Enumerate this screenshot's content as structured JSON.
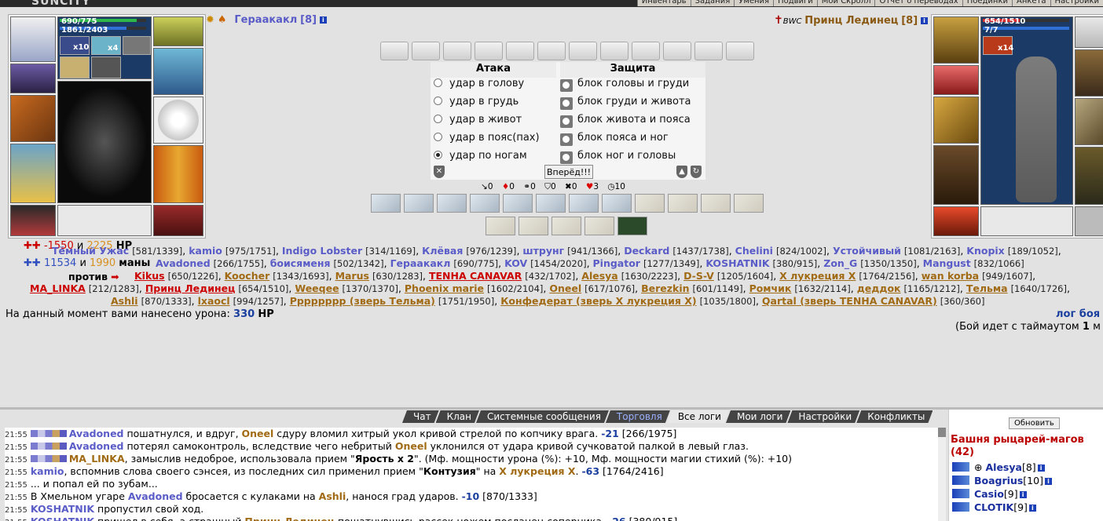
{
  "app": {
    "logo": "SUNCITY"
  },
  "top_menu": [
    "Инвентарь",
    "Задания",
    "Умения",
    "Подвиги",
    "Мой Скролл",
    "Отчет о переводах",
    "Поединки",
    "Анкета",
    "Настройки"
  ],
  "player_left": {
    "name": "Гераакакл",
    "level": "[8]",
    "hp": "690/775",
    "mana": "1861/2403",
    "stack1": "x10",
    "stack2": "x4",
    "hp_fraction": 0.89,
    "mana_fraction": 0.77
  },
  "player_right": {
    "name": "Принц Лединец",
    "level": "[8]",
    "hp": "654/1510",
    "mana": "7/7",
    "stack1": "x14",
    "clan_tag": "BWC",
    "hp_fraction": 0.43,
    "mana_fraction": 1.0
  },
  "attack": {
    "title": "Атака",
    "options": [
      "удар в голову",
      "удар в грудь",
      "удар в живот",
      "удар в пояс(пах)",
      "удар по ногам"
    ],
    "selected": 4
  },
  "defense": {
    "title": "Защита",
    "options": [
      "блок головы и груди",
      "блок груди и живота",
      "блок живота и пояса",
      "блок пояса и ног",
      "блок ног и головы"
    ]
  },
  "forward_button": "Вперёд!!!",
  "counters": [
    "0",
    "0",
    "0",
    "0",
    "0",
    "3",
    "10"
  ],
  "hp_summary": {
    "hp": "-1550",
    "and": "и",
    "hp2": "2225",
    "hp_label": "HP",
    "mana": "11534",
    "and2": "и",
    "mana2": "1990",
    "mana_label": "маны"
  },
  "team_left": [
    {
      "n": "Тёмный Ужас",
      "h": "[581/1339]"
    },
    {
      "n": "kamio",
      "h": "[975/1751]"
    },
    {
      "n": "Indigo Lobster",
      "h": "[314/1169]"
    },
    {
      "n": "Клёвая",
      "h": "[976/1239]"
    },
    {
      "n": "штрунг",
      "h": "[941/1366]"
    },
    {
      "n": "Deckard",
      "h": "[1437/1738]"
    },
    {
      "n": "Chelini",
      "h": "[824/1002]"
    },
    {
      "n": "Устойчивый",
      "h": "[1081/2163]"
    },
    {
      "n": "Knopix",
      "h": "[189/1052]"
    },
    {
      "n": "Avadoned",
      "h": "[266/1755]"
    },
    {
      "n": "боисяменя",
      "h": "[502/1342]"
    },
    {
      "n": "Гераакакл",
      "h": "[690/775]"
    },
    {
      "n": "KOV",
      "h": "[1454/2020]"
    },
    {
      "n": "Pingator",
      "h": "[1277/1349]"
    },
    {
      "n": "KOSHATNIK",
      "h": "[380/915]"
    },
    {
      "n": "Zon_G",
      "h": "[1350/1350]"
    },
    {
      "n": "Mangust",
      "h": "[832/1066]"
    }
  ],
  "versus": "против",
  "team_right": [
    {
      "n": "Kikus",
      "h": "[650/1226]",
      "s": "r"
    },
    {
      "n": "Koocher",
      "h": "[1343/1693]",
      "s": "e"
    },
    {
      "n": "Marus",
      "h": "[630/1283]",
      "s": "e"
    },
    {
      "n": "TENHA CANAVAR",
      "h": "[432/1702]",
      "s": "r"
    },
    {
      "n": "Alesya",
      "h": "[1630/2223]",
      "s": "e"
    },
    {
      "n": "D-S-V",
      "h": "[1205/1604]",
      "s": "e"
    },
    {
      "n": "X лукреция X",
      "h": "[1764/2156]",
      "s": "e"
    },
    {
      "n": "wan korba",
      "h": "[949/1607]",
      "s": "e"
    },
    {
      "n": "MA_LINKA",
      "h": "[212/1283]",
      "s": "r"
    },
    {
      "n": "Принц Лединец",
      "h": "[654/1510]",
      "s": "r"
    },
    {
      "n": "Weeqee",
      "h": "[1370/1370]",
      "s": "e"
    },
    {
      "n": "Phoenix marie",
      "h": "[1602/2104]",
      "s": "e"
    },
    {
      "n": "Oneel",
      "h": "[617/1076]",
      "s": "e"
    },
    {
      "n": "Berezkin",
      "h": "[601/1149]",
      "s": "e"
    },
    {
      "n": "Ромчик",
      "h": "[1632/2114]",
      "s": "e"
    },
    {
      "n": "деддок",
      "h": "[1165/1212]",
      "s": "e"
    },
    {
      "n": "Тельма",
      "h": "[1640/1726]",
      "s": "e"
    },
    {
      "n": "Ashli",
      "h": "[870/1333]",
      "s": "e"
    },
    {
      "n": "lxaocl",
      "h": "[994/1257]",
      "s": "e"
    },
    {
      "n": "Рррррррр (зверь Тельма)",
      "h": "[1751/1950]",
      "s": "e"
    },
    {
      "n": "Конфедерат (зверь X лукреция X)",
      "h": "[1035/1800]",
      "s": "e"
    },
    {
      "n": "Qartal (зверь TENHA CANAVAR)",
      "h": "[360/360]",
      "s": "e"
    }
  ],
  "damage_line": {
    "text": "На данный момент вами нанесено урона:",
    "value": "330",
    "unit": "HP"
  },
  "log_link": "лог боя",
  "timeout": {
    "prefix": "(Бой идет с таймаутом",
    "value": "1",
    "suffix": "м"
  },
  "tabs": [
    "Чат",
    "Клан",
    "Системные сообщения",
    "Торговля",
    "Все логи",
    "Мои логи",
    "Настройки",
    "Конфликты"
  ],
  "active_tab": "Все логи",
  "log": [
    {
      "t": "21:55",
      "parts": [
        [
          "p",
          "Avadoned"
        ],
        [
          "x",
          " пошатнулся, и вдруг, "
        ],
        [
          "e",
          "Oneel"
        ],
        [
          "x",
          " сдуру вломил хитрый укол кривой стрелой по копчику врага. "
        ],
        [
          "d",
          "-21"
        ],
        [
          "x",
          " [266/1975]"
        ]
      ]
    },
    {
      "t": "21:55",
      "parts": [
        [
          "p",
          "Avadoned"
        ],
        [
          "x",
          " потерял самоконтроль, вследствие чего небритый "
        ],
        [
          "e",
          "Oneel"
        ],
        [
          "x",
          " уклонился от удара кривой сучковатой палкой в левый глаз."
        ]
      ]
    },
    {
      "t": "21:55",
      "parts": [
        [
          "e",
          "MA_LINKA"
        ],
        [
          "x",
          ", замыслив недоброе, использовала прием \""
        ],
        [
          "b",
          "Ярость x 2"
        ],
        [
          "x",
          "\". (Мф. мощности урона (%): +10, Мф. мощности магии стихий (%): +10)"
        ]
      ]
    },
    {
      "t": "21:55",
      "parts": [
        [
          "p",
          "kamio"
        ],
        [
          "x",
          ", вспомнив слова своего сэнсея, из последних сил применил прием \""
        ],
        [
          "b",
          "Контузия"
        ],
        [
          "x",
          "\" на "
        ],
        [
          "e",
          "X лукреция X"
        ],
        [
          "x",
          ". "
        ],
        [
          "d",
          "-63"
        ],
        [
          "x",
          " [1764/2416]"
        ]
      ]
    },
    {
      "t": "21:55",
      "parts": [
        [
          "x",
          "... и попал ей по зубам..."
        ]
      ]
    },
    {
      "t": "21:55",
      "parts": [
        [
          "x",
          "В Хмельном угаре "
        ],
        [
          "p",
          "Avadoned"
        ],
        [
          "x",
          " бросается с кулаками на "
        ],
        [
          "e",
          "Ashli"
        ],
        [
          "x",
          ", нанося град ударов. "
        ],
        [
          "d",
          "-10"
        ],
        [
          "x",
          " [870/1333]"
        ]
      ]
    },
    {
      "t": "21:55",
      "parts": [
        [
          "p",
          "KOSHATNIK"
        ],
        [
          "x",
          " пропустил свой ход."
        ]
      ]
    },
    {
      "t": "21:55",
      "parts": [
        [
          "p",
          "KOSHATNIK"
        ],
        [
          "x",
          " пришел в себя, а страшный "
        ],
        [
          "e",
          "Принц Лединец"
        ],
        [
          "x",
          " пошатнувшись рассек ножем посланец соперника. "
        ],
        [
          "d",
          "-26"
        ],
        [
          "x",
          " [380/915]"
        ]
      ]
    }
  ],
  "side": {
    "refresh": "Обновить",
    "title": "Башня рыцарей-магов (42)",
    "members": [
      {
        "name": "Alesya",
        "lvl": "[8]"
      },
      {
        "name": "Boagrius",
        "lvl": "[10]"
      },
      {
        "name": "Casio",
        "lvl": "[9]"
      },
      {
        "name": "CLOTIK",
        "lvl": "[9]"
      }
    ]
  }
}
